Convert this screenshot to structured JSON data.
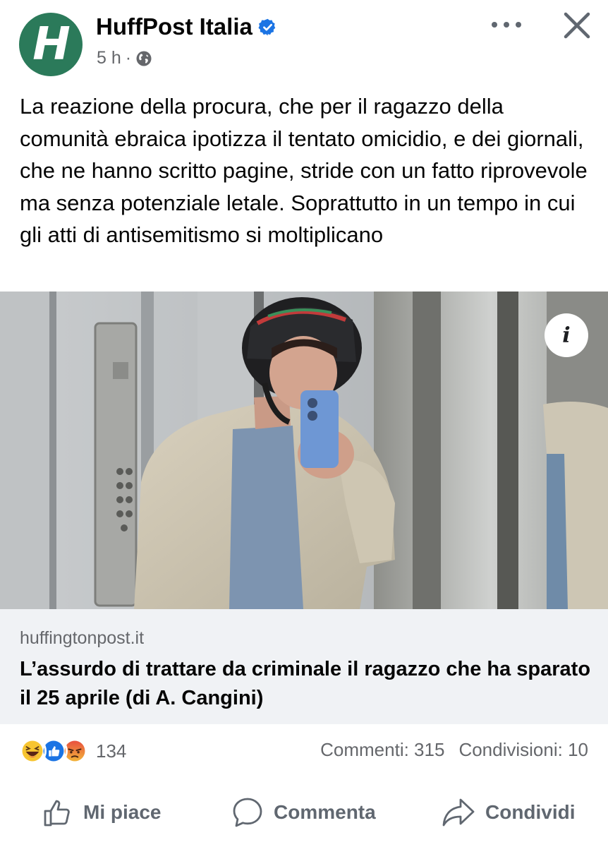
{
  "post": {
    "page_name": "HuffPost Italia",
    "avatar_letter": "H",
    "time": "5 h",
    "separator": "·",
    "verified_icon": "verified-badge-icon",
    "audience_icon": "globe-icon",
    "text": "La reazione della procura, che per il ragazzo della comunità ebraica ipotizza il tentato omicidio, e dei giornali, che ne hanno scritto pagine, stride con un fatto riprovevole ma senza potenziale letale. Soprattutto in un tempo in cui gli atti di antisemitismo si moltiplicano"
  },
  "image": {
    "info_label": "i"
  },
  "link": {
    "domain": "huffingtonpost.it",
    "title": "L’assurdo di trattare da criminale il ragazzo che ha sparato il 25 aprile (di A. Cangini)"
  },
  "engagement": {
    "reaction_icons": [
      "haha-icon",
      "like-icon",
      "angry-icon"
    ],
    "reaction_count": "134",
    "comments": "Commenti: 315",
    "shares": "Condivisioni: 10"
  },
  "actions": {
    "like": "Mi piace",
    "comment": "Commenta",
    "share": "Condividi"
  },
  "colors": {
    "brand_green": "#2b7a5a",
    "verified_blue": "#1b74e4",
    "secondary_text": "#65676b",
    "link_bg": "#f0f2f5"
  }
}
